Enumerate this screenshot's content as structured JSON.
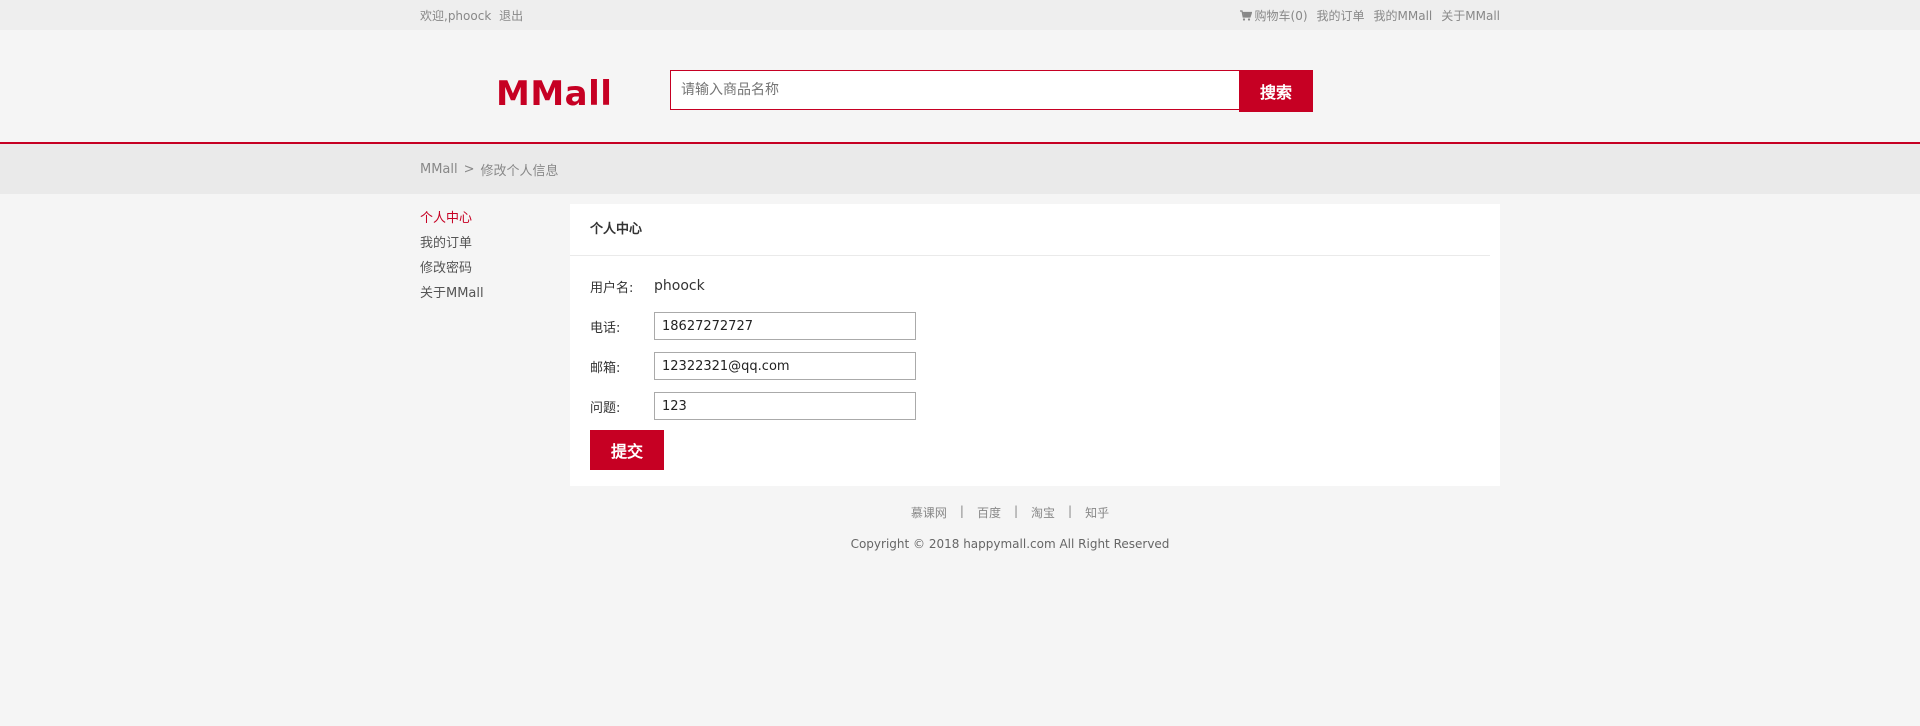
{
  "topbar": {
    "welcome": "欢迎,phoock",
    "logout": "退出",
    "cart": "购物车(0)",
    "my_orders": "我的订单",
    "my_mmall": "我的MMall",
    "about": "关于MMall"
  },
  "header": {
    "logo": "MMall",
    "search_placeholder": "请输入商品名称",
    "search_button": "搜索"
  },
  "breadcrumb": {
    "root": "MMall",
    "separator": ">",
    "current": "修改个人信息"
  },
  "sidebar": {
    "items": [
      {
        "label": "个人中心"
      },
      {
        "label": "我的订单"
      },
      {
        "label": "修改密码"
      },
      {
        "label": "关于MMall"
      }
    ]
  },
  "panel": {
    "title": "个人中心",
    "username_label": "用户名:",
    "username_value": "phoock",
    "phone_label": "电话:",
    "phone_value": "18627272727",
    "email_label": "邮箱:",
    "email_value": "12322321@qq.com",
    "question_label": "问题:",
    "question_value": "123",
    "submit_label": "提交"
  },
  "footer": {
    "links": [
      {
        "label": "慕课网"
      },
      {
        "label": "百度"
      },
      {
        "label": "淘宝"
      },
      {
        "label": "知乎"
      }
    ],
    "separator": "|",
    "copyright": "Copyright © 2018 happymall.com All Right Reserved"
  },
  "colors": {
    "brand": "#c60023"
  }
}
